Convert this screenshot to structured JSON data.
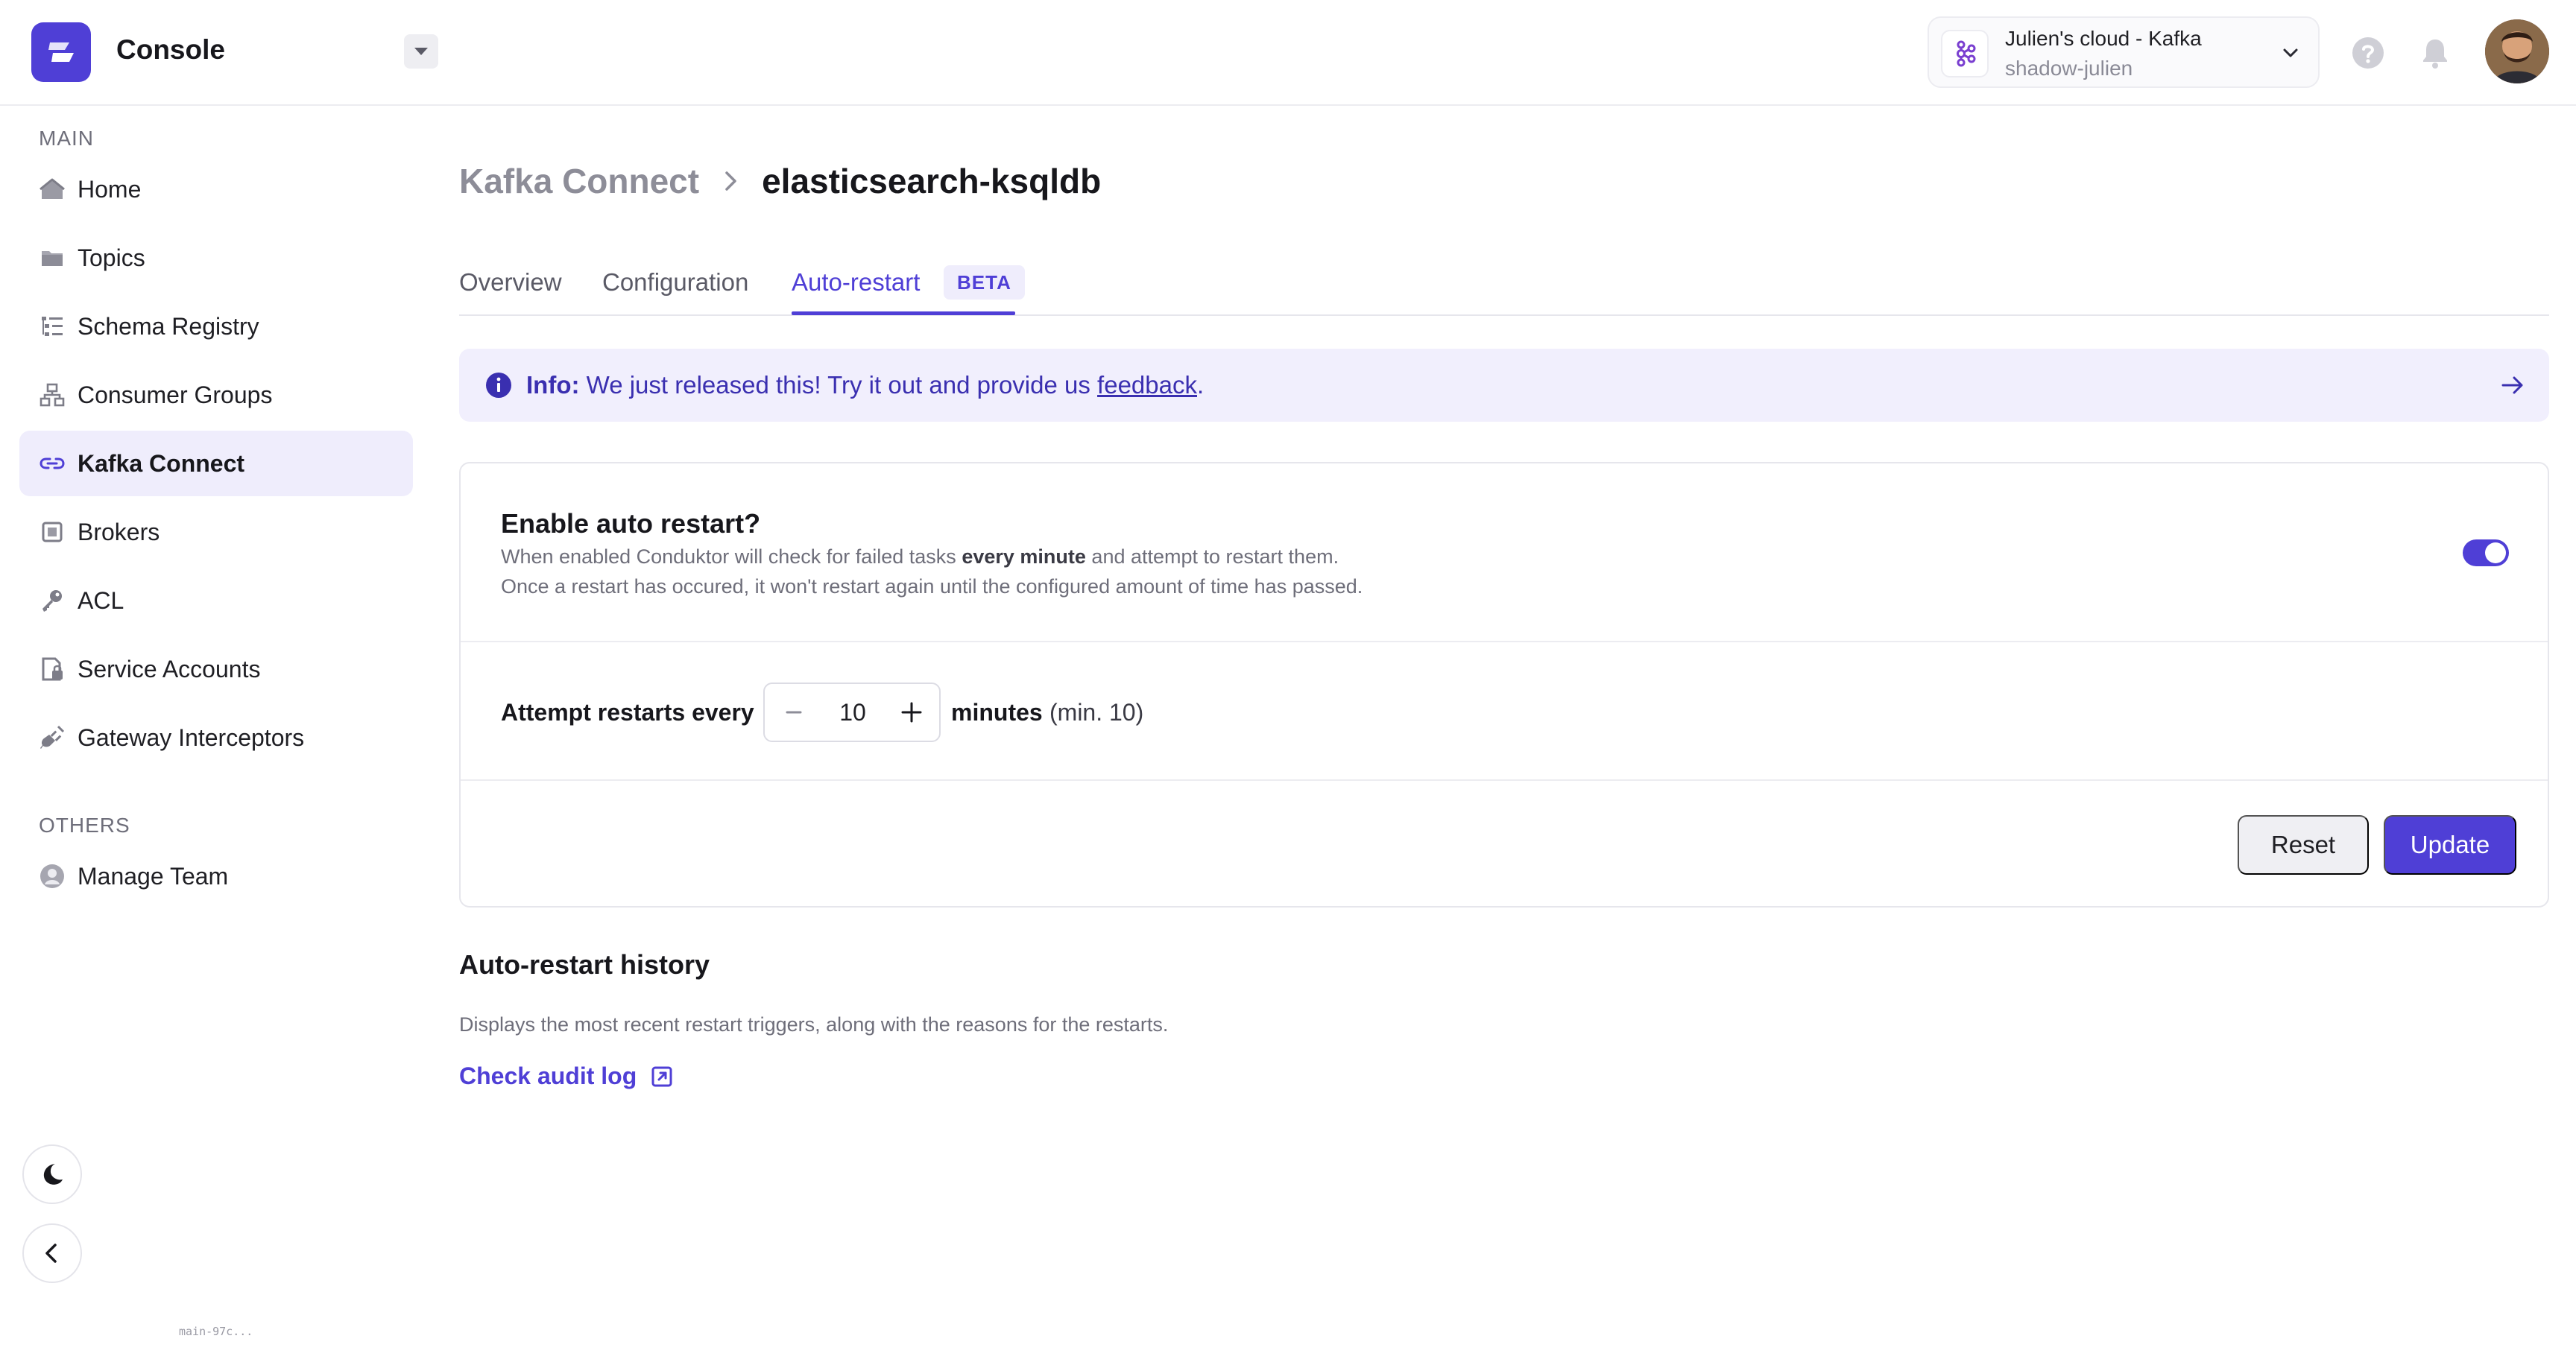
{
  "app": {
    "title": "Console",
    "build": "main-97c..."
  },
  "cluster": {
    "name": "Julien's cloud - Kafka",
    "id": "shadow-julien"
  },
  "sidebar": {
    "main_label": "MAIN",
    "others_label": "OTHERS",
    "items": [
      {
        "label": "Home",
        "icon": "home-icon"
      },
      {
        "label": "Topics",
        "icon": "folder-icon"
      },
      {
        "label": "Schema Registry",
        "icon": "schema-icon"
      },
      {
        "label": "Consumer Groups",
        "icon": "consumer-groups-icon"
      },
      {
        "label": "Kafka Connect",
        "icon": "link-icon",
        "active": true
      },
      {
        "label": "Brokers",
        "icon": "chip-icon"
      },
      {
        "label": "ACL",
        "icon": "key-icon"
      },
      {
        "label": "Service Accounts",
        "icon": "service-account-icon"
      },
      {
        "label": "Gateway Interceptors",
        "icon": "plug-icon"
      }
    ],
    "others": [
      {
        "label": "Manage Team",
        "icon": "user-icon"
      }
    ]
  },
  "breadcrumb": {
    "parent": "Kafka Connect",
    "current": "elasticsearch-ksqldb"
  },
  "tabs": [
    {
      "label": "Overview"
    },
    {
      "label": "Configuration"
    },
    {
      "label": "Auto-restart",
      "badge": "BETA",
      "active": true
    }
  ],
  "info": {
    "prefix": "Info:",
    "text": "We just released this! Try it out and provide us",
    "link": "feedback",
    "suffix": "."
  },
  "auto_restart": {
    "title": "Enable auto restart?",
    "desc1_pre": "When enabled Conduktor will check for failed tasks",
    "desc1_bold": "every minute",
    "desc1_post": "and attempt to restart them.",
    "desc2": "Once a restart has occured, it won't restart again until the configured amount of time has passed.",
    "enabled": true,
    "attempt_label": "Attempt restarts every",
    "interval_value": "10",
    "unit_label": "minutes",
    "min_hint": "(min. 10)",
    "reset_label": "Reset",
    "update_label": "Update"
  },
  "history": {
    "title": "Auto-restart history",
    "desc": "Displays the most recent restart triggers, along with the reasons for the restarts.",
    "link": "Check audit log"
  },
  "colors": {
    "accent": "#4f3fd6",
    "accent_soft": "#efedfc",
    "info_bg": "#f1effd"
  }
}
